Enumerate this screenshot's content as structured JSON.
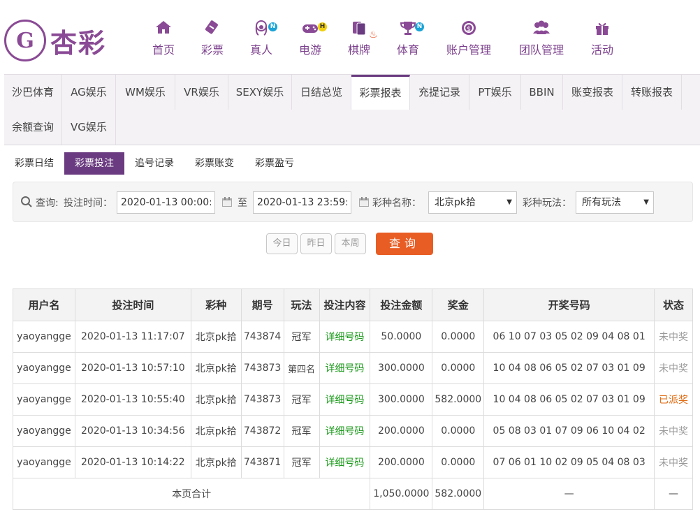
{
  "logo": {
    "mark": "G",
    "text": "杏彩"
  },
  "nav": [
    {
      "label": "首页",
      "icon": "home-icon"
    },
    {
      "label": "彩票",
      "icon": "lottery-ticket-icon"
    },
    {
      "label": "真人",
      "icon": "live-dealer-icon",
      "badge": "N"
    },
    {
      "label": "电游",
      "icon": "gamepad-icon",
      "badge": "H"
    },
    {
      "label": "棋牌",
      "icon": "cards-icon"
    },
    {
      "label": "体育",
      "icon": "trophy-icon",
      "badge": "N"
    },
    {
      "label": "账户管理",
      "icon": "account-icon"
    },
    {
      "label": "团队管理",
      "icon": "team-icon"
    },
    {
      "label": "活动",
      "icon": "gift-icon"
    }
  ],
  "tabs": [
    "沙巴体育",
    "AG娱乐",
    "WM娱乐",
    "VR娱乐",
    "SEXY娱乐",
    "日结总览",
    "彩票报表",
    "充提记录",
    "PT娱乐",
    "BBIN",
    "账变报表",
    "转账报表",
    "余额查询",
    "VG娱乐"
  ],
  "subtabs": [
    "彩票日结",
    "彩票投注",
    "追号记录",
    "彩票账变",
    "彩票盈亏"
  ],
  "query": {
    "label": "查询:",
    "time_label": "投注时间：",
    "start": "2020-01-13 00:00:00",
    "to": "至",
    "end": "2020-01-13 23:59:59",
    "lottery_label": "彩种名称：",
    "lottery_value": "北京pk拾",
    "play_label": "彩种玩法：",
    "play_value": "所有玩法"
  },
  "quick_buttons": [
    "今日",
    "昨日",
    "本周"
  ],
  "search_button": "查询",
  "table": {
    "headers": [
      "用户名",
      "投注时间",
      "彩种",
      "期号",
      "玩法",
      "投注内容",
      "投注金额",
      "奖金",
      "开奖号码",
      "状态"
    ],
    "rows": [
      [
        "yaoyangge",
        "2020-01-13 11:17:07",
        "北京pk拾",
        "743874",
        "冠军",
        "详细号码",
        "50.0000",
        "0.0000",
        "06 10 07 03 05 02 09 04 08 01",
        "未中奖"
      ],
      [
        "yaoyangge",
        "2020-01-13 10:57:10",
        "北京pk拾",
        "743873",
        "第四名",
        "详细号码",
        "300.0000",
        "0.0000",
        "10 04 08 06 05 02 07 03 01 09",
        "未中奖"
      ],
      [
        "yaoyangge",
        "2020-01-13 10:55:40",
        "北京pk拾",
        "743873",
        "冠军",
        "详细号码",
        "300.0000",
        "582.0000",
        "10 04 08 06 05 02 07 03 01 09",
        "已派奖"
      ],
      [
        "yaoyangge",
        "2020-01-13 10:34:56",
        "北京pk拾",
        "743872",
        "冠军",
        "详细号码",
        "200.0000",
        "0.0000",
        "05 08 03 01 07 09 06 10 04 02",
        "未中奖"
      ],
      [
        "yaoyangge",
        "2020-01-13 10:14:22",
        "北京pk拾",
        "743871",
        "冠军",
        "详细号码",
        "200.0000",
        "0.0000",
        "07 06 01 10 02 09 05 04 08 03",
        "未中奖"
      ]
    ],
    "footer": {
      "label": "本页合计",
      "amount": "1,050.0000",
      "prize": "582.0000",
      "numbers": "—",
      "status": "—"
    }
  },
  "colors": {
    "brand": "#7b3f8c",
    "accent": "#e85d24",
    "win": "#1a9a1a"
  }
}
